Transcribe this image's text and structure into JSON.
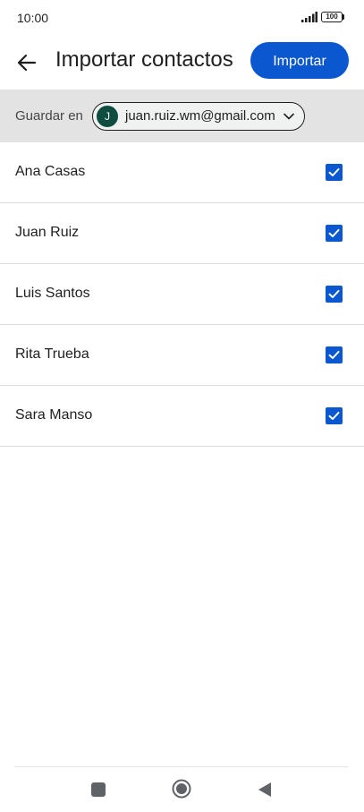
{
  "status_bar": {
    "time": "10:00",
    "battery_level": "100",
    "signal_icon": "signal-bars-icon",
    "battery_icon": "battery-icon"
  },
  "header": {
    "back_icon": "arrow-left-icon",
    "title": "Importar contactos",
    "import_label": "Importar"
  },
  "save_bar": {
    "label": "Guardar en",
    "account": {
      "initial": "J",
      "email": "juan.ruiz.wm@gmail.com",
      "dropdown_icon": "chevron-down-icon"
    }
  },
  "contacts": [
    {
      "name": "Ana Casas",
      "checked": true
    },
    {
      "name": "Juan Ruiz",
      "checked": true
    },
    {
      "name": "Luis Santos",
      "checked": true
    },
    {
      "name": "Rita Trueba",
      "checked": true
    },
    {
      "name": "Sara Manso",
      "checked": true
    }
  ],
  "nav_bar": {
    "recents_icon": "square-icon",
    "home_icon": "circle-icon",
    "back_icon": "triangle-back-icon"
  },
  "colors": {
    "accent": "#0b57d0",
    "save_bar_background": "#e3e3e3",
    "avatar_background": "#0e4d3f",
    "divider": "#dadce0"
  }
}
